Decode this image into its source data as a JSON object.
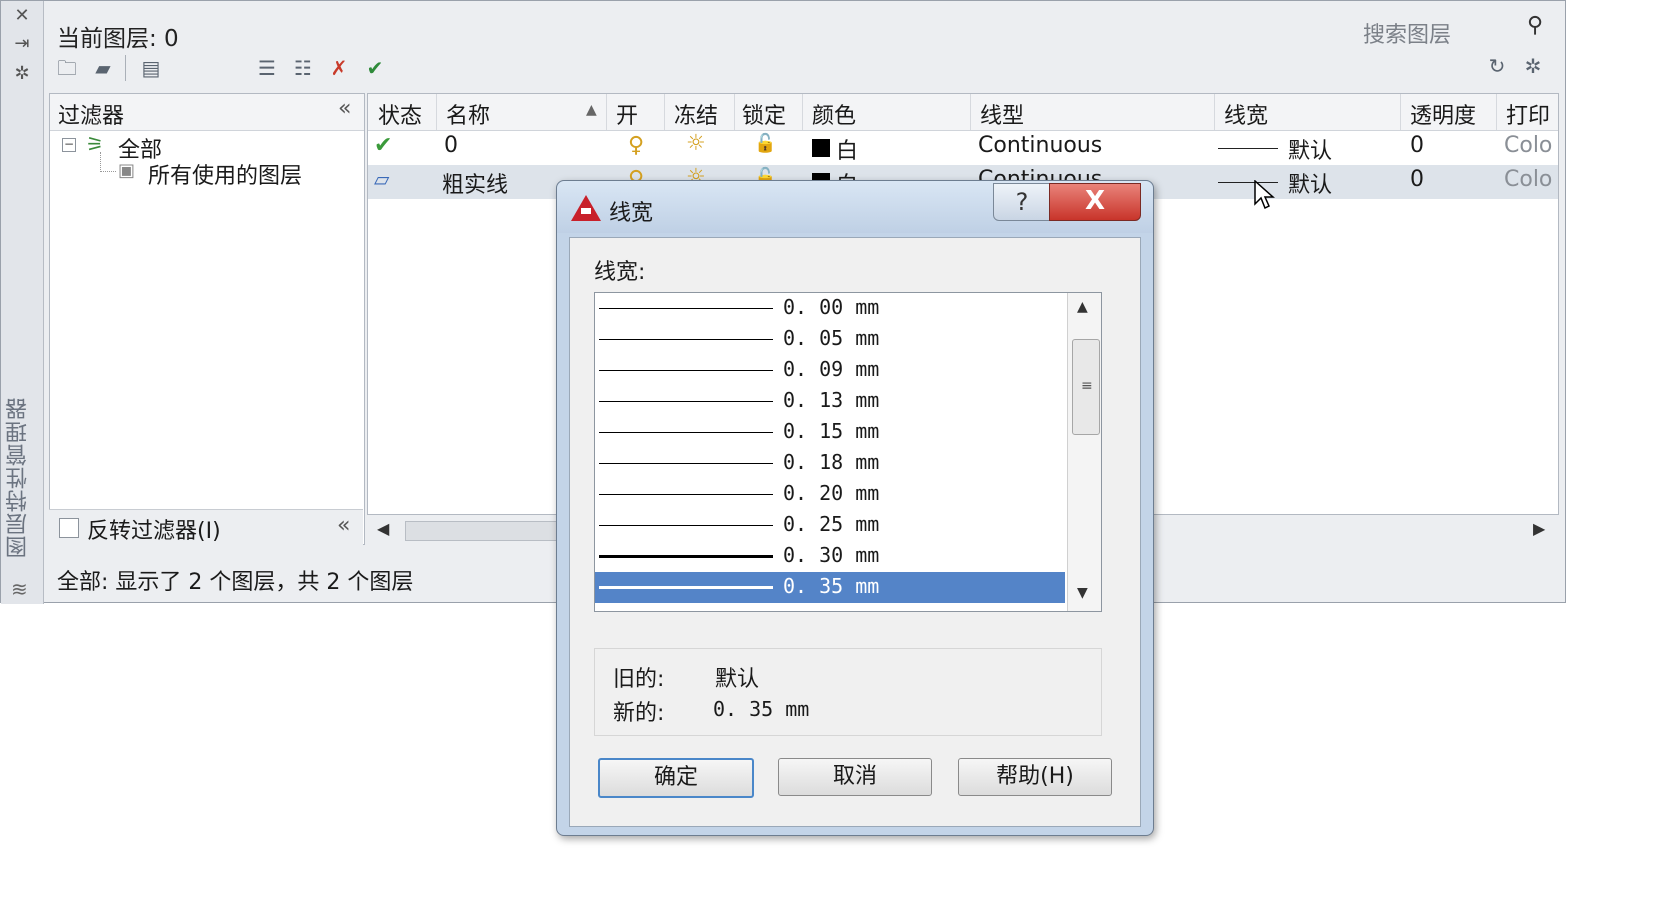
{
  "palette": {
    "current_layer": "当前图层: 0",
    "side_title": "图层特性管理器",
    "search_placeholder": "搜索图层",
    "status": "全部: 显示了 2 个图层，共 2 个图层"
  },
  "filter_panel": {
    "title": "过滤器",
    "collapse": "«",
    "tree": {
      "expander": "−",
      "all": "全部",
      "used": "所有使用的图层"
    },
    "invert_label": "反转过滤器(I)"
  },
  "grid": {
    "columns": [
      "状态",
      "名称",
      "开",
      "冻结",
      "锁定",
      "颜色",
      "线型",
      "线宽",
      "透明度",
      "打印"
    ],
    "rows": [
      {
        "name": "0",
        "color": "白",
        "linetype": "Continuous",
        "lineweight": "默认",
        "transparency": "0",
        "plot": "Colo"
      },
      {
        "name": "粗实线",
        "color": "白",
        "linetype": "Continuous",
        "lineweight": "默认",
        "transparency": "0",
        "plot": "Colo"
      }
    ]
  },
  "dialog": {
    "title": "线宽",
    "list_label": "线宽:",
    "items": [
      "0. 00  mm",
      "0. 05  mm",
      "0. 09  mm",
      "0. 13  mm",
      "0. 15  mm",
      "0. 18  mm",
      "0. 20  mm",
      "0. 25  mm",
      "0. 30  mm",
      "0. 35  mm"
    ],
    "selected_item": "0. 35  mm",
    "old_label": "旧的:",
    "old_value": "默认",
    "new_label": "新的:",
    "new_value": "0. 35  mm",
    "ok": "确定",
    "cancel": "取消",
    "help": "帮助(H)",
    "help_icon": "?",
    "close_icon": "X"
  },
  "icons": {
    "check": "✔",
    "bulb": "♀",
    "sun": "☼",
    "lock": "🔓",
    "search": "⚲",
    "refresh": "↻",
    "gear": "✲"
  },
  "colors": {
    "accent": "#5484c8",
    "selected_row": "#dde3ea",
    "close_button": "#c8342a"
  }
}
